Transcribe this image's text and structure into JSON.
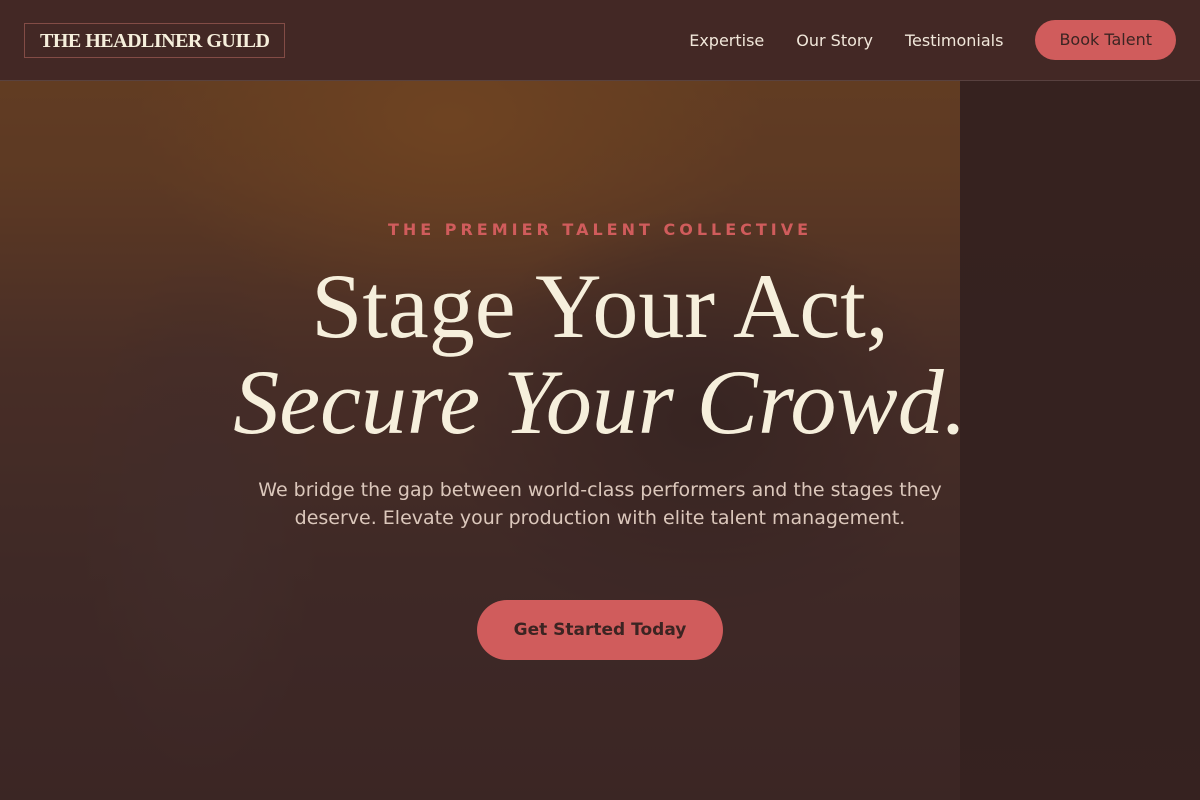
{
  "header": {
    "logo": "THE HEADLINER GUILD",
    "nav": [
      "Expertise",
      "Our Story",
      "Testimonials"
    ],
    "cta_label": "Book Talent"
  },
  "hero": {
    "eyebrow": "THE PREMIER TALENT COLLECTIVE",
    "title_line1": "Stage Your Act,",
    "title_line2": "Secure Your Crowd.",
    "subtitle": "We bridge the gap between world-class performers and the stages they deserve. Elevate your production with elite talent management.",
    "cta_label": "Get Started Today"
  },
  "colors": {
    "accent": "#d05c5c",
    "header_bg": "#422825",
    "title_cream": "#f6efdc"
  }
}
